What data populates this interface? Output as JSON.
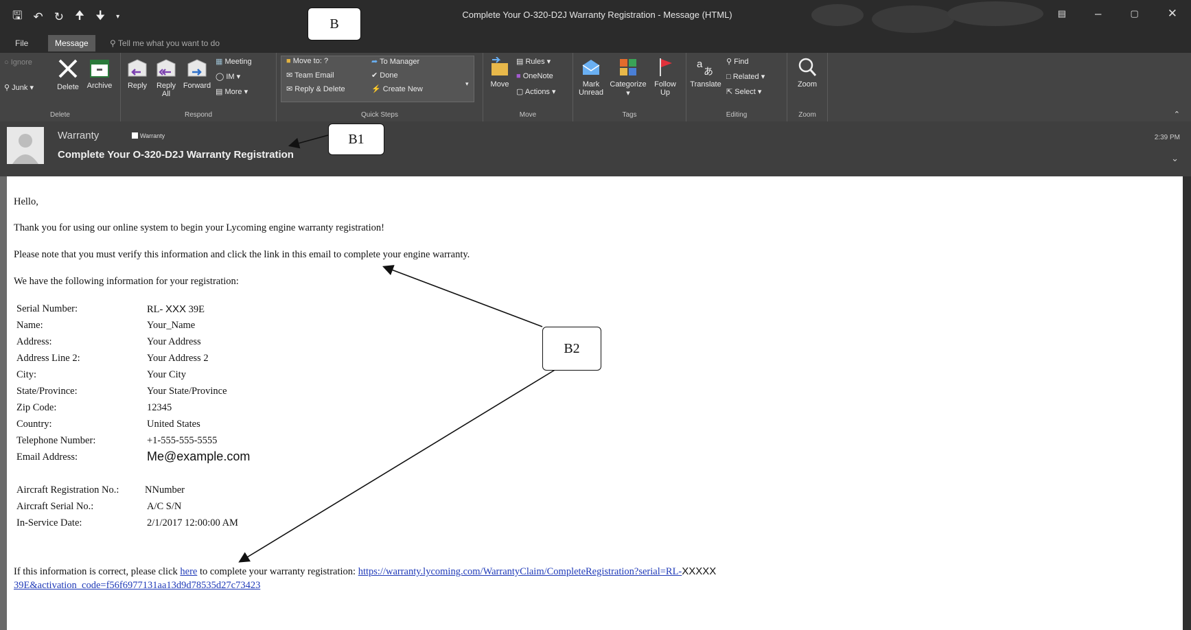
{
  "window": {
    "title": "Complete Your O-320-D2J  Warranty Registration - Message (HTML)",
    "qat_icons": [
      "save-icon",
      "undo-icon",
      "redo-icon",
      "up-arrow-icon",
      "down-arrow-icon",
      "customize-icon"
    ],
    "controls": [
      "restore-ribbon-icon",
      "minimize-icon",
      "maximize-icon",
      "close-icon"
    ]
  },
  "tabs": {
    "file": "File",
    "message": "Message",
    "tell_me": "Tell me what you want to do"
  },
  "ribbon": {
    "delete_group": {
      "label": "Delete",
      "ignore": "Ignore",
      "junk": "Junk",
      "delete": "Delete",
      "archive": "Archive"
    },
    "respond_group": {
      "label": "Respond",
      "reply": "Reply",
      "reply_all_line1": "Reply",
      "reply_all_line2": "All",
      "forward": "Forward",
      "meeting": "Meeting",
      "im": "IM",
      "more": "More"
    },
    "quicksteps_group": {
      "label": "Quick Steps",
      "move_to": "Move to: ?",
      "team_email": "Team Email",
      "reply_delete": "Reply & Delete",
      "to_manager": "To Manager",
      "done": "Done",
      "create_new": "Create New"
    },
    "move_group": {
      "label": "Move",
      "move": "Move",
      "rules": "Rules",
      "onenote": "OneNote",
      "actions": "Actions"
    },
    "tags_group": {
      "label": "Tags",
      "mark_unread_line1": "Mark",
      "mark_unread_line2": "Unread",
      "categorize": "Categorize",
      "follow_up_line1": "Follow",
      "follow_up_line2": "Up"
    },
    "editing_group": {
      "label": "Editing",
      "translate": "Translate",
      "find": "Find",
      "related": "Related",
      "select": "Select"
    },
    "zoom_group": {
      "label": "Zoom",
      "zoom": "Zoom"
    }
  },
  "message": {
    "sender": "Warranty",
    "category": "Warranty",
    "subject": "Complete Your O-320-D2J  Warranty Registration",
    "time": "2:39 PM"
  },
  "email": {
    "greeting": "Hello,",
    "line1": "Thank you for using our online system to begin your Lycoming engine warranty registration!",
    "line2": "Please note that you must verify this information and click the link in this email to complete your engine warranty.",
    "line3": "We have the following information for your registration:",
    "fields": [
      {
        "label": "Serial Number:",
        "value_a": "RL-",
        "value_redact": "XXX",
        "value_b": "39E"
      },
      {
        "label": "Name:",
        "value": "Your_Name"
      },
      {
        "label": "Address:",
        "value": "Your Address"
      },
      {
        "label": "Address Line 2:",
        "value": "Your Address 2"
      },
      {
        "label": "City:",
        "value": "Your City"
      },
      {
        "label": "State/Province:",
        "value": "Your State/Province"
      },
      {
        "label": "Zip Code:",
        "value": "12345"
      },
      {
        "label": "Country:",
        "value": "United States"
      },
      {
        "label": "Telephone Number:",
        "value": "+1-555-555-5555"
      },
      {
        "label": "Email Address:",
        "value": "Me@example.com"
      }
    ],
    "aircraft_fields": [
      {
        "label": "Aircraft Registration No.:",
        "value": "NNumber"
      },
      {
        "label": "Aircraft Serial No.:",
        "value": "A/C S/N"
      },
      {
        "label": "In-Service Date:",
        "value": "2/1/2017 12:00:00 AM"
      }
    ],
    "closing_pre": "If this information is correct, please click",
    "closing_link": "here",
    "closing_post": "to complete your warranty registration:",
    "url_part1": "https://warranty.lycoming.com/WarrantyClaim/CompleteRegistration?serial=RL-",
    "url_redact": "XXXXX",
    "url_part2": "39E&activation_code=f56f6977131aa13d9d78535d27c73423"
  },
  "callouts": {
    "b": "B",
    "b1": "B1",
    "b2": "B2"
  }
}
